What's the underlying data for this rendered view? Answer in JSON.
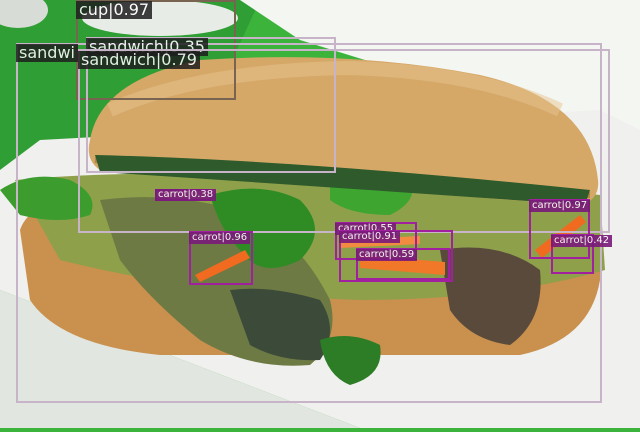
{
  "colors": {
    "sandwich_box": "#c8b4c8",
    "cup_box": "#786450",
    "carrot_box": "#a020a0",
    "label_bg_dark": "#1e1e1e",
    "label_bg_carrot": "#7a1a7a",
    "background_green": "#3cb43c",
    "plate": "#f0f0ee",
    "bread": "#d6a868"
  },
  "detections": [
    {
      "id": "d1",
      "label": "cup|0.97",
      "class": "cup"
    },
    {
      "id": "d2",
      "label": "sandwi",
      "class": "sandwich"
    },
    {
      "id": "d3",
      "label": "sandwich|0.35",
      "class": "sandwich"
    },
    {
      "id": "d4",
      "label": "sandwich|0.79",
      "class": "sandwich"
    },
    {
      "id": "d5",
      "label": "carrot|0.38",
      "class": "carrot"
    },
    {
      "id": "d6",
      "label": "carrot|0.96",
      "class": "carrot"
    },
    {
      "id": "d7",
      "label": "carrot|0.55",
      "class": "carrot"
    },
    {
      "id": "d8",
      "label": "carrot|0.91",
      "class": "carrot"
    },
    {
      "id": "d9",
      "label": "carrot|0.59",
      "class": "carrot"
    },
    {
      "id": "d10",
      "label": "carrot|0.97",
      "class": "carrot"
    },
    {
      "id": "d11",
      "label": "carrot|0.42",
      "class": "carrot"
    }
  ]
}
